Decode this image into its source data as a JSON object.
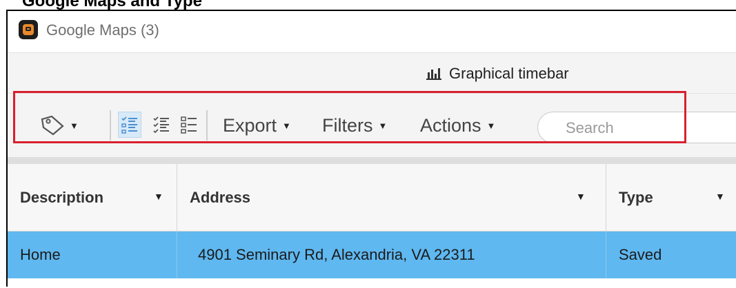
{
  "caption": {
    "text": "Google Maps and Type"
  },
  "app": {
    "title": "Google Maps (3)",
    "logo_icon": "google-maps-app-icon",
    "logo_color": "#e8892f"
  },
  "subbar": {
    "timebar_label": "Graphical timebar",
    "timebar_icon": "bar-chart-icon"
  },
  "toolbar": {
    "tag_icon": "tag-icon",
    "view_icons": [
      "detailed-list-icon",
      "checklist-icon",
      "compact-list-icon"
    ],
    "export_label": "Export",
    "filters_label": "Filters",
    "actions_label": "Actions",
    "search_placeholder": "Search"
  },
  "table": {
    "columns": [
      "Description",
      "Address",
      "Type"
    ],
    "rows": [
      {
        "description": "Home",
        "address": "4901 Seminary Rd, Alexandria, VA 22311",
        "type": "Saved"
      }
    ],
    "selected_row_color": "#5fb8f0",
    "highlight_color": "#d81f2e"
  }
}
